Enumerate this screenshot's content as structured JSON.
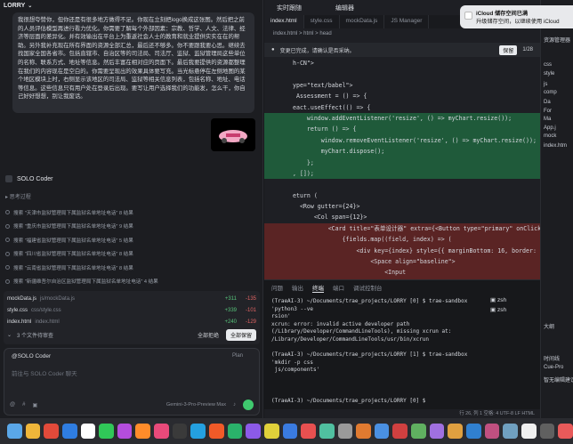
{
  "chat": {
    "project": "LORRY",
    "user_message": "我很想夸赞你，但你还是有很多地方做得不足。你现在立刻把logo换成这张图。然后把之前的人员评估模型再进行看力优化。你需要了解每个外部因素：宗教、哲学、人文、法律、经济等层面的差异化。并有效输出在平台上为重返社会人士的教育和就业提供实实在在的帮助。另外我补充现在所有界面的资源全部汇总，最后还不够多。你不要跟我要心思。继续去找国家全国各省市。包括直辖市、自治区等的司法局、司法厅、监狱、监狱管理局这些单位的名称、联系方式、地址等信息。然后丰富在相对应的页面下。最后我要提供的资源都整理在我们的内容现在是空白的。你需要呈现出的效果具体要写充。当光标悬停在左侧地图的某个地区模块上时，右侧显示该地区的司法局、监狱等相关信息列表，包括名称、地址、电话等信息。这些信息只有用户处在登录后出现。要写让用户选择我们的功能发，怎么干，你自己好好想想，别让我废话。",
    "assistant_name": "SOLO Coder",
    "thinking_label": "思考过程",
    "steps": [
      "搜索 \"天津市监狱管理局下属监狱名单地址电话\" 8 结果",
      "搜索 \"重庆市监狱管理局下属监狱名单地址电话\" 9 结果",
      "搜索 \"福建省监狱管理局下属监狱名单地址电话\" 5 结果",
      "搜索 \"四川省监狱管理局下属监狱名单地址电话\" 8 结果",
      "搜索 \"云南省监狱管理局下属监狱名单地址电话\" 8 结果",
      "搜索 \"新疆维吾尔自治区监狱管理局下属监狱名单地址电话\" 4 结果",
      "搜索 \"黑龙江省监狱管理局下属监狱名单地址电话\" 5 结果"
    ],
    "files": [
      {
        "name": "mockData.js",
        "path": "js/mockData.js",
        "add": "+311",
        "del": "-135"
      },
      {
        "name": "style.css",
        "path": "css/style.css",
        "add": "+339",
        "del": "-101"
      },
      {
        "name": "index.html",
        "path": "index.html",
        "add": "+240",
        "del": "-129"
      }
    ],
    "pending_label": "3 个文件待审查",
    "reject_all": "全部拒绝",
    "keep_all": "全部保留",
    "input_mention": "@SOLO Coder",
    "plan_label": "Plan",
    "input_placeholder": "前往与 SOLO Coder 聊天",
    "model_label": "Gemini-3-Pro-Preview Max"
  },
  "editor": {
    "run_tab_a": "实时跟随",
    "run_tab_b": "编辑器",
    "tabs": [
      "index.html",
      "style.css",
      "mockData.js",
      "JS Manager"
    ],
    "breadcrumb": "index.html > html > head",
    "review_message": "变更已完成，请确认是否采纳。",
    "review_counter": "1/28",
    "keep_label": "保留",
    "code_lines": [
      {
        "t": "h-CN\">",
        "k": ""
      },
      {
        "t": "",
        "k": ""
      },
      {
        "t": "ype=\"text/babel\">",
        "k": ""
      },
      {
        "t": " Assessment = () => {",
        "k": ""
      },
      {
        "t": "eact.useEffect(() => {",
        "k": ""
      },
      {
        "t": "    window.addEventListener('resize', () => myChart.resize());",
        "k": "g"
      },
      {
        "t": "    return () => {",
        "k": "g"
      },
      {
        "t": "        window.removeEventListener('resize', () => myChart.resize());",
        "k": "g"
      },
      {
        "t": "        myChart.dispose();",
        "k": "g"
      },
      {
        "t": "    };",
        "k": "g"
      },
      {
        "t": ", []);",
        "k": "g"
      },
      {
        "t": "",
        "k": ""
      },
      {
        "t": "eturn (",
        "k": ""
      },
      {
        "t": "  <Row gutter={24}>",
        "k": ""
      },
      {
        "t": "      <Col span={12}>",
        "k": ""
      },
      {
        "t": "          <Card title=\"表单设计器\" extra={<Button type=\"primary\" onClick",
        "k": "r"
      },
      {
        "t": "              {fields.map((field, index) => (",
        "k": "r"
      },
      {
        "t": "                  <div key={index} style={{ marginBottom: 16, border:",
        "k": "r"
      },
      {
        "t": "                      <Space align=\"baseline\">",
        "k": "r"
      },
      {
        "t": "                          <Input",
        "k": "r"
      },
      {
        "t": "                              value={field.label}",
        "k": "r"
      },
      {
        "t": "                              onChange={(e) => updateField(index, 'l",
        "k": "r"
      }
    ],
    "panel_tabs": [
      "问题",
      "输出",
      "终端",
      "端口",
      "调试控制台"
    ],
    "terminal_text": "(TraeAI-3) ~/Documents/trae_projects/LORRY [0] $ trae-sandbox 'python3 --ve\nrsion'\nxcrun: error: invalid active developer path (/Library/Developer/CommandLineTools), missing xcrun at: /Library/Developer/CommandLineTools/usr/bin/xcrun\n\n(TraeAI-3) ~/Documents/trae_projects/LORRY [1] $ trae-sandbox 'mkdir -p css\n js/components'\n\n\n\n(TraeAI-3) ~/Documents/trae_projects/LORRY [0] $ ",
    "shells": [
      "zsh",
      "zsh"
    ],
    "status": "行 26, 列 1  空格: 4  UTF-8  LF  HTML"
  },
  "sidebar": {
    "items": [
      "资源管理器",
      "css",
      "style",
      "js",
      "comp",
      "Da",
      "For",
      "Ma",
      "App.j",
      "mock",
      "index.htm",
      "大纲",
      "时间线",
      "Cue-Pro",
      "智无编辑建议"
    ]
  },
  "notification": {
    "title": "iCloud 储存空间已满",
    "body": "升级储存空间，以继续使用 iCloud"
  },
  "dock": {
    "colors": [
      "#5aa7e8",
      "#f0b63a",
      "#e24a3a",
      "#2f7de1",
      "#ffffff",
      "#30c758",
      "#b44ddd",
      "#ff8c2a",
      "#e84a7a",
      "#3a3a3a",
      "#24a0e0",
      "#f05a28",
      "#2ab26a",
      "#8c5ae8",
      "#e0d03a",
      "#3a7be0",
      "#e85050",
      "#50c0a0",
      "#9a9a9a",
      "#e07a30",
      "#4a90e2",
      "#d04040",
      "#60b060",
      "#a070e0",
      "#e0a040",
      "#3080d0",
      "#c05080",
      "#70a0c0",
      "#f0f0f0",
      "#606060",
      "#e85a5a"
    ]
  }
}
